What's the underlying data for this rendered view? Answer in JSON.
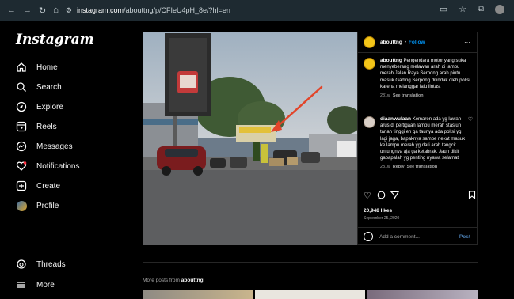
{
  "browser": {
    "host": "instagram.com",
    "path": "/abouttng/p/CFIeU4pH_8e/?hl=en"
  },
  "sidebar": {
    "logo": "Instagram",
    "items": [
      {
        "label": "Home",
        "icon": "home-icon"
      },
      {
        "label": "Search",
        "icon": "search-icon"
      },
      {
        "label": "Explore",
        "icon": "compass-icon"
      },
      {
        "label": "Reels",
        "icon": "reels-icon"
      },
      {
        "label": "Messages",
        "icon": "messenger-icon"
      },
      {
        "label": "Notifications",
        "icon": "heart-icon"
      },
      {
        "label": "Create",
        "icon": "plus-square-icon"
      },
      {
        "label": "Profile",
        "icon": "profile-avatar"
      },
      {
        "label": "Threads",
        "icon": "threads-icon"
      },
      {
        "label": "More",
        "icon": "menu-icon"
      }
    ]
  },
  "post": {
    "username": "abouttng",
    "separator": "•",
    "follow_label": "Follow",
    "more": "···",
    "caption": "Pengendara motor yang suka menyeberang melawan arah di lampu merah Jalan Raya Serpong arah pintu masuk Gading Serpong ditindak oleh polisi karena melanggar lalu lintas.",
    "caption_age": "231w",
    "see_translation": "See translation",
    "comment": {
      "username": "diaanwulaan",
      "text": "Kemaren ada yg lawan arus di pertigaan lampu merah stasiun tanah tinggi eh ga taunya ada polisi yg lagi jaga, bapaknya sampe nekat masuk ke lampu merah yg dari arah tangcit untungnya aja ga ketabrak. Jauh dikit gapapalah yg penting nyawa selamat",
      "age": "231w",
      "reply": "Reply",
      "see_translation": "See translation"
    },
    "likes": "20,948 likes",
    "date": "September 25, 2020",
    "add_comment_placeholder": "Add a comment...",
    "post_button": "Post"
  },
  "more_posts": {
    "prefix": "More posts from",
    "username": "abouttng"
  },
  "colors": {
    "accent": "#0095f6",
    "background": "#000000",
    "chrome": "#1e2a31"
  }
}
